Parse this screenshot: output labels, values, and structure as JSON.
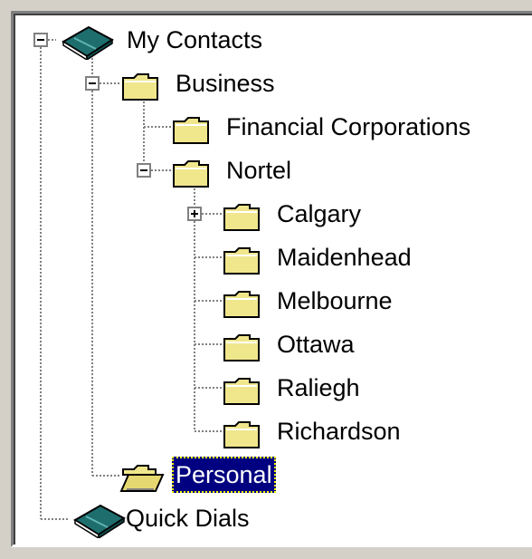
{
  "tree": {
    "nodes": [
      {
        "id": "my-contacts",
        "label": "My Contacts",
        "icon": "address-book-icon",
        "expanded": true
      },
      {
        "id": "business",
        "label": "Business",
        "icon": "folder-icon",
        "expanded": true
      },
      {
        "id": "financial-corporations",
        "label": "Financial Corporations",
        "icon": "folder-icon"
      },
      {
        "id": "nortel",
        "label": "Nortel",
        "icon": "folder-icon",
        "expanded": true
      },
      {
        "id": "calgary",
        "label": "Calgary",
        "icon": "folder-icon",
        "expanded": false
      },
      {
        "id": "maidenhead",
        "label": "Maidenhead",
        "icon": "folder-icon"
      },
      {
        "id": "melbourne",
        "label": "Melbourne",
        "icon": "folder-icon"
      },
      {
        "id": "ottawa",
        "label": "Ottawa",
        "icon": "folder-icon"
      },
      {
        "id": "raliegh",
        "label": "Raliegh",
        "icon": "folder-icon"
      },
      {
        "id": "richardson",
        "label": "Richardson",
        "icon": "folder-icon"
      },
      {
        "id": "personal",
        "label": "Personal",
        "icon": "open-folder-icon",
        "selected": true
      },
      {
        "id": "quick-dials",
        "label": "Quick Dials",
        "icon": "address-book-icon"
      }
    ]
  },
  "colors": {
    "selection_bg": "#000080",
    "selection_fg": "#ffffff",
    "folder_fill": "#f0e68c",
    "book_fill": "#1e6e6e"
  }
}
